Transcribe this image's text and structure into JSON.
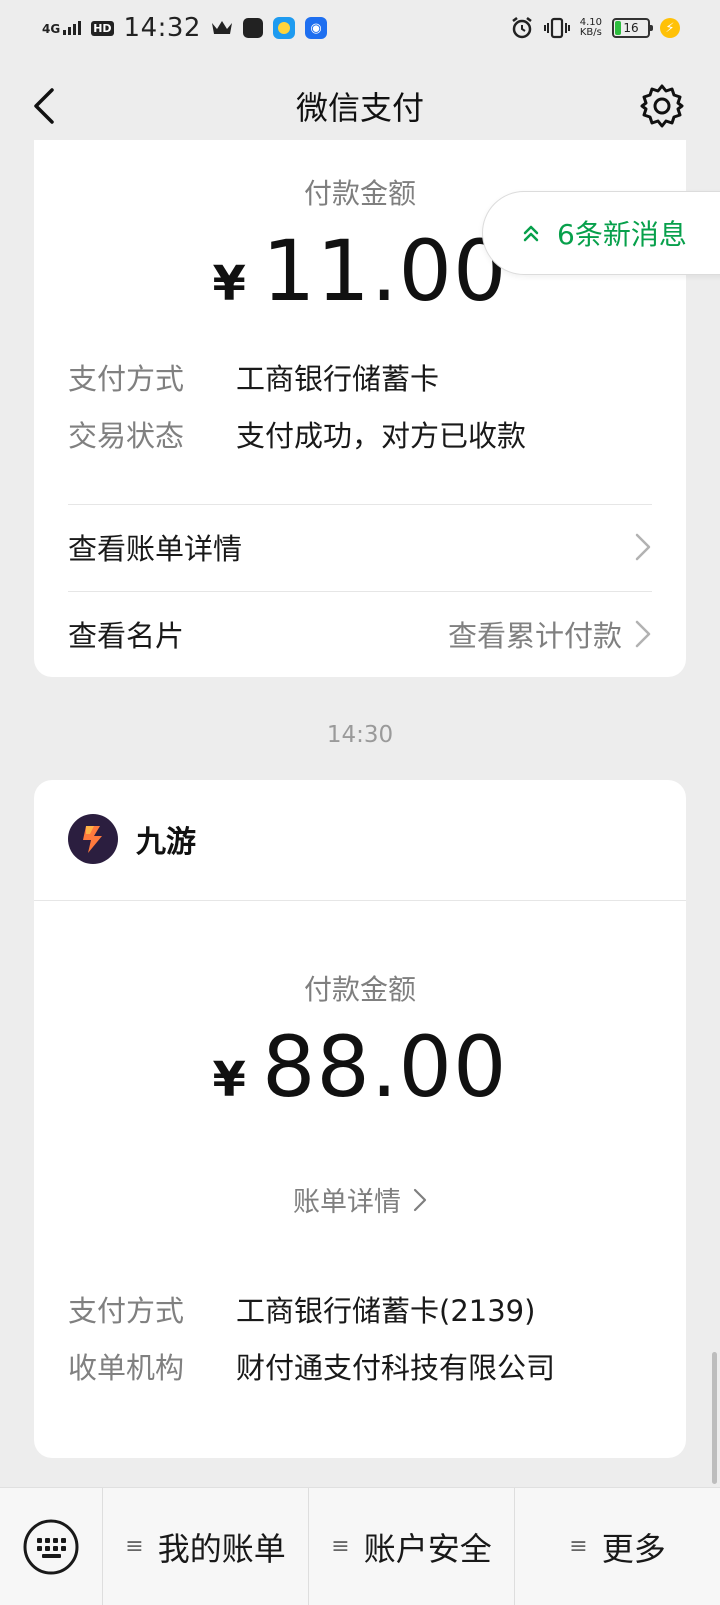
{
  "status_bar": {
    "network": "4G",
    "hd": "HD",
    "time": "14:32",
    "speed_value": "4.10",
    "speed_unit": "KB/s",
    "battery": "16"
  },
  "nav": {
    "title": "微信支付",
    "back_icon": "chevron-left-icon",
    "settings_icon": "gear-icon"
  },
  "new_messages": {
    "label": "6条新消息",
    "icon": "double-chevron-up-icon",
    "color": "#07a04b"
  },
  "card1": {
    "amount_label": "付款金额",
    "currency": "¥",
    "amount": "11.00",
    "info": [
      {
        "key": "支付方式",
        "value": "工商银行储蓄卡"
      },
      {
        "key": "交易状态",
        "value": "支付成功，对方已收款"
      }
    ],
    "links": [
      {
        "label": "查看账单详情",
        "right": ""
      },
      {
        "label": "查看名片",
        "right": "查看累计付款"
      }
    ]
  },
  "timestamp": "14:30",
  "card2": {
    "merchant": "九游",
    "amount_label": "付款金额",
    "currency": "¥",
    "amount": "88.00",
    "bill_link": "账单详情",
    "info": [
      {
        "key": "支付方式",
        "value": "工商银行储蓄卡(2139)"
      },
      {
        "key": "收单机构",
        "value": "财付通支付科技有限公司"
      }
    ]
  },
  "bottom_bar": {
    "keyboard_icon": "keyboard-icon",
    "menu_icon": "≡",
    "items": [
      "我的账单",
      "账户安全",
      "更多"
    ]
  }
}
